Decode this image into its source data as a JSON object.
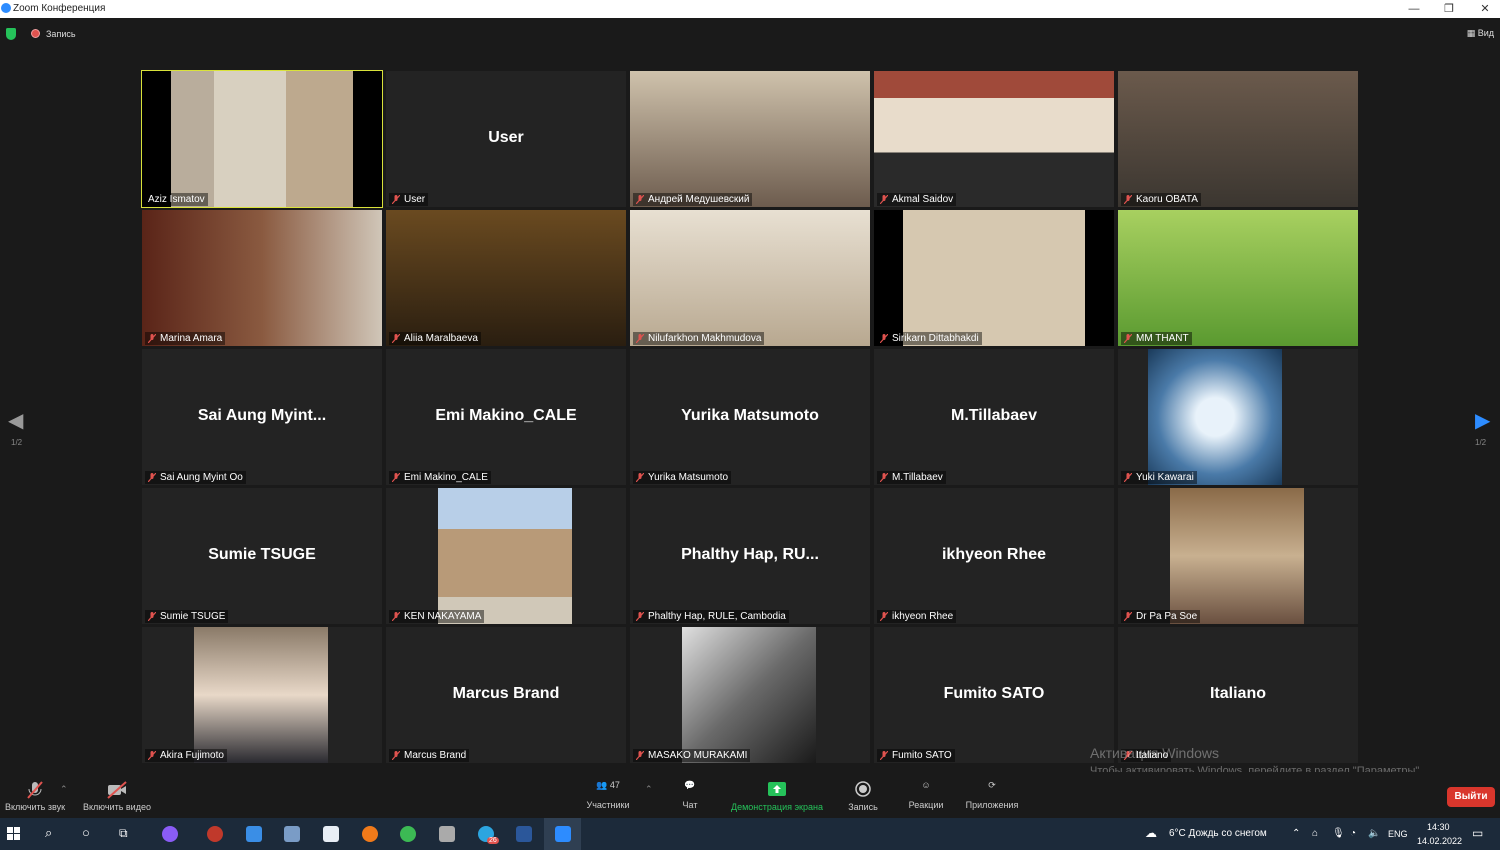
{
  "window": {
    "title": "Zoom Конференция"
  },
  "top": {
    "recording_label": "Запись",
    "view_label": "Вид"
  },
  "nav": {
    "page": "1/2"
  },
  "tiles": [
    {
      "label": "Aziz Ismatov",
      "big": "",
      "video": "bookshelf"
    },
    {
      "label": "User",
      "big": "User",
      "video": ""
    },
    {
      "label": "Андрей Медушевский",
      "big": "",
      "video": "room"
    },
    {
      "label": "Akmal Saidov",
      "big": "",
      "video": "office"
    },
    {
      "label": "Kaoru OBATA",
      "big": "",
      "video": "dim"
    },
    {
      "label": "Marina Amara",
      "big": "",
      "video": "library"
    },
    {
      "label": "Aliia Maralbaeva",
      "big": "",
      "video": "warm"
    },
    {
      "label": "Nilufarkhon Makhmudova",
      "big": "",
      "video": "light"
    },
    {
      "label": "Sirikarn Dittabhakdi",
      "big": "",
      "video": "beige"
    },
    {
      "label": "MM THANT",
      "big": "",
      "video": "grass"
    },
    {
      "label": "Sai Aung Myint Oo",
      "big": "Sai Aung Myint...",
      "video": ""
    },
    {
      "label": "Emi Makino_CALE",
      "big": "Emi Makino_CALE",
      "video": ""
    },
    {
      "label": "Yurika Matsumoto",
      "big": "Yurika Matsumoto",
      "video": ""
    },
    {
      "label": "M.Tillabaev",
      "big": "M.Tillabaev",
      "video": ""
    },
    {
      "label": "Yuki Kawarai",
      "big": "",
      "video": "snow"
    },
    {
      "label": "Sumie TSUGE",
      "big": "Sumie TSUGE",
      "video": ""
    },
    {
      "label": "KEN NAKAYAMA",
      "big": "",
      "video": "mosque"
    },
    {
      "label": "Phalthy Hap, RULE, Cambodia",
      "big": "Phalthy Hap, RU...",
      "video": ""
    },
    {
      "label": "ikhyeon Rhee",
      "big": "ikhyeon Rhee",
      "video": ""
    },
    {
      "label": "Dr Pa Pa Soe",
      "big": "",
      "video": "portrait"
    },
    {
      "label": "Akira Fujimoto",
      "big": "",
      "video": "man"
    },
    {
      "label": "Marcus Brand",
      "big": "Marcus Brand",
      "video": ""
    },
    {
      "label": "MASAKO MURAKAMI",
      "big": "",
      "video": "dog"
    },
    {
      "label": "Fumito SATO",
      "big": "Fumito SATO",
      "video": ""
    },
    {
      "label": "Italiano",
      "big": "Italiano",
      "video": ""
    }
  ],
  "toolbar": {
    "audio": "Включить звук",
    "video": "Включить видео",
    "participants_count": "47",
    "participants": "Участники",
    "chat": "Чат",
    "share": "Демонстрация экрана",
    "record": "Запись",
    "reactions": "Реакции",
    "apps": "Приложения",
    "leave": "Выйти"
  },
  "watermark": {
    "line1": "Активация Windows",
    "line2": "Чтобы активировать Windows, перейдите в раздел \"Параметры\"."
  },
  "taskbar": {
    "weather": "6°C  Дождь со снегом",
    "lang": "ENG",
    "time": "14:30",
    "date": "14.02.2022",
    "telegram_badge": "26"
  },
  "colors": {
    "accent_green": "#25c25a",
    "active_border": "#d9e23a",
    "leave_red": "#d9362c",
    "muted_red": "#e0534f"
  }
}
